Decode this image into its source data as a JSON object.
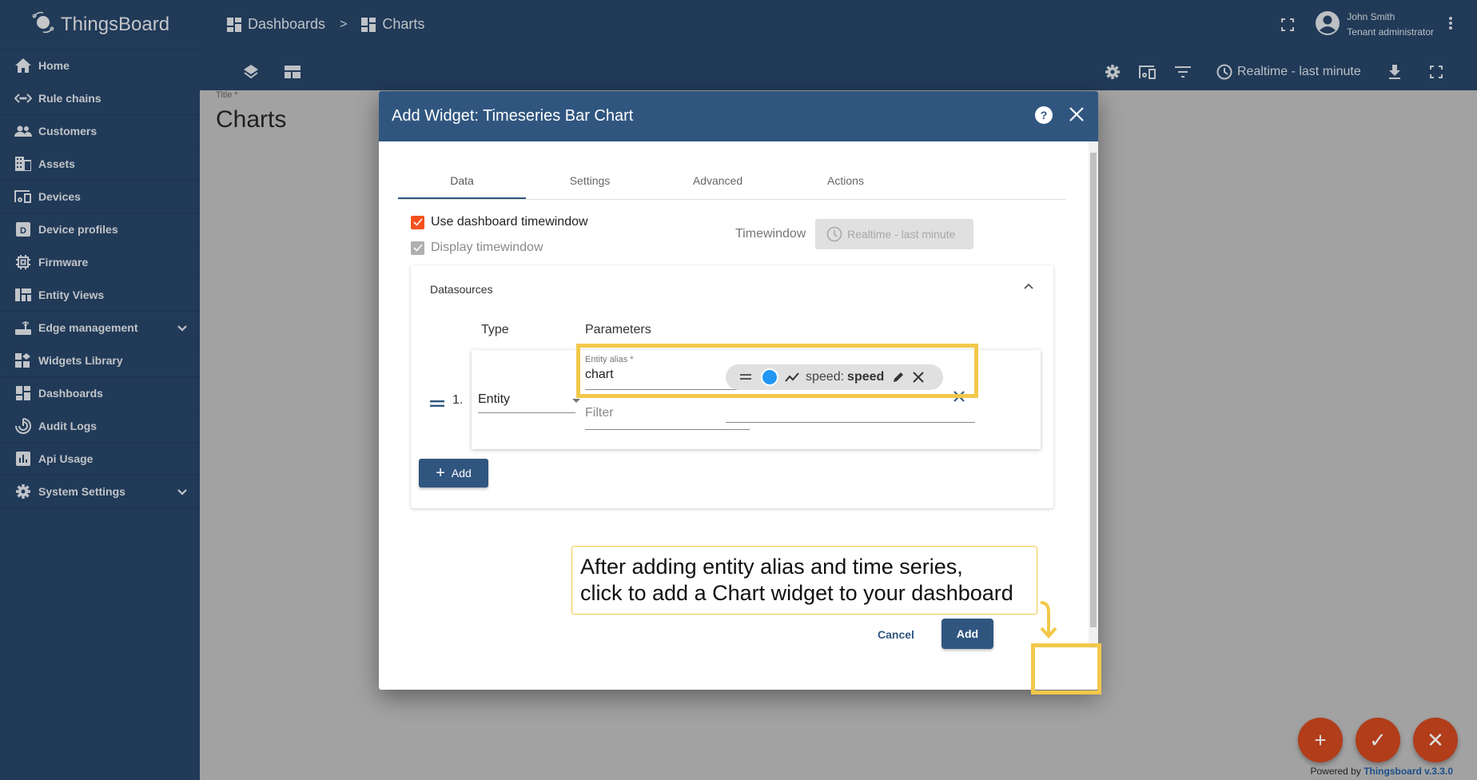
{
  "app": {
    "name": "ThingsBoard"
  },
  "sidebar": {
    "items": [
      {
        "label": "Home",
        "icon": "home-icon"
      },
      {
        "label": "Rule chains",
        "icon": "rule-chains-icon"
      },
      {
        "label": "Customers",
        "icon": "customers-icon"
      },
      {
        "label": "Assets",
        "icon": "assets-icon"
      },
      {
        "label": "Devices",
        "icon": "devices-icon"
      },
      {
        "label": "Device profiles",
        "icon": "device-profiles-icon"
      },
      {
        "label": "Firmware",
        "icon": "firmware-icon"
      },
      {
        "label": "Entity Views",
        "icon": "entity-views-icon"
      },
      {
        "label": "Edge management",
        "icon": "edge-icon",
        "expandable": true
      },
      {
        "label": "Widgets Library",
        "icon": "widgets-icon"
      },
      {
        "label": "Dashboards",
        "icon": "dashboards-icon"
      },
      {
        "label": "Audit Logs",
        "icon": "audit-logs-icon"
      },
      {
        "label": "Api Usage",
        "icon": "api-usage-icon"
      },
      {
        "label": "System Settings",
        "icon": "settings-icon",
        "expandable": true
      }
    ]
  },
  "header": {
    "breadcrumb": [
      "Dashboards",
      "Charts"
    ],
    "breadcrumb_sep": ">",
    "user": {
      "name": "John Smith",
      "role": "Tenant administrator"
    },
    "timewindow": "Realtime - last minute"
  },
  "page": {
    "title_label": "Title *",
    "title_value": "Charts",
    "powered_by": "Powered by",
    "powered_link": "Thingsboard v.3.3.0"
  },
  "dialog": {
    "title": "Add Widget: Timeseries Bar Chart",
    "tabs": [
      "Data",
      "Settings",
      "Advanced",
      "Actions"
    ],
    "active_tab": "Data",
    "use_dashboard_timewindow": {
      "label": "Use dashboard timewindow",
      "checked": true
    },
    "display_timewindow": {
      "label": "Display timewindow",
      "checked": true,
      "disabled": true
    },
    "timewindow_label": "Timewindow",
    "timewindow_value": "Realtime - last minute",
    "datasources": {
      "title": "Datasources",
      "col_type": "Type",
      "col_params": "Parameters",
      "rows": [
        {
          "index": "1.",
          "type": "Entity",
          "alias_label": "Entity alias *",
          "alias_value": "chart",
          "filter_placeholder": "Filter",
          "key_chip": {
            "prefix": "speed:",
            "label": "speed",
            "color": "#2196f3"
          }
        }
      ],
      "add_label": "Add"
    },
    "cancel_label": "Cancel",
    "add_label": "Add"
  },
  "annotation": {
    "tooltip_line1": "After adding entity alias and time series,",
    "tooltip_line2": "click to add a Chart widget to your dashboard",
    "highlight_color": "#f2c84b"
  },
  "colors": {
    "primary": "#305680",
    "sidebar": "#213a58",
    "accent": "#f4511e",
    "fab": "#b13d1a"
  }
}
